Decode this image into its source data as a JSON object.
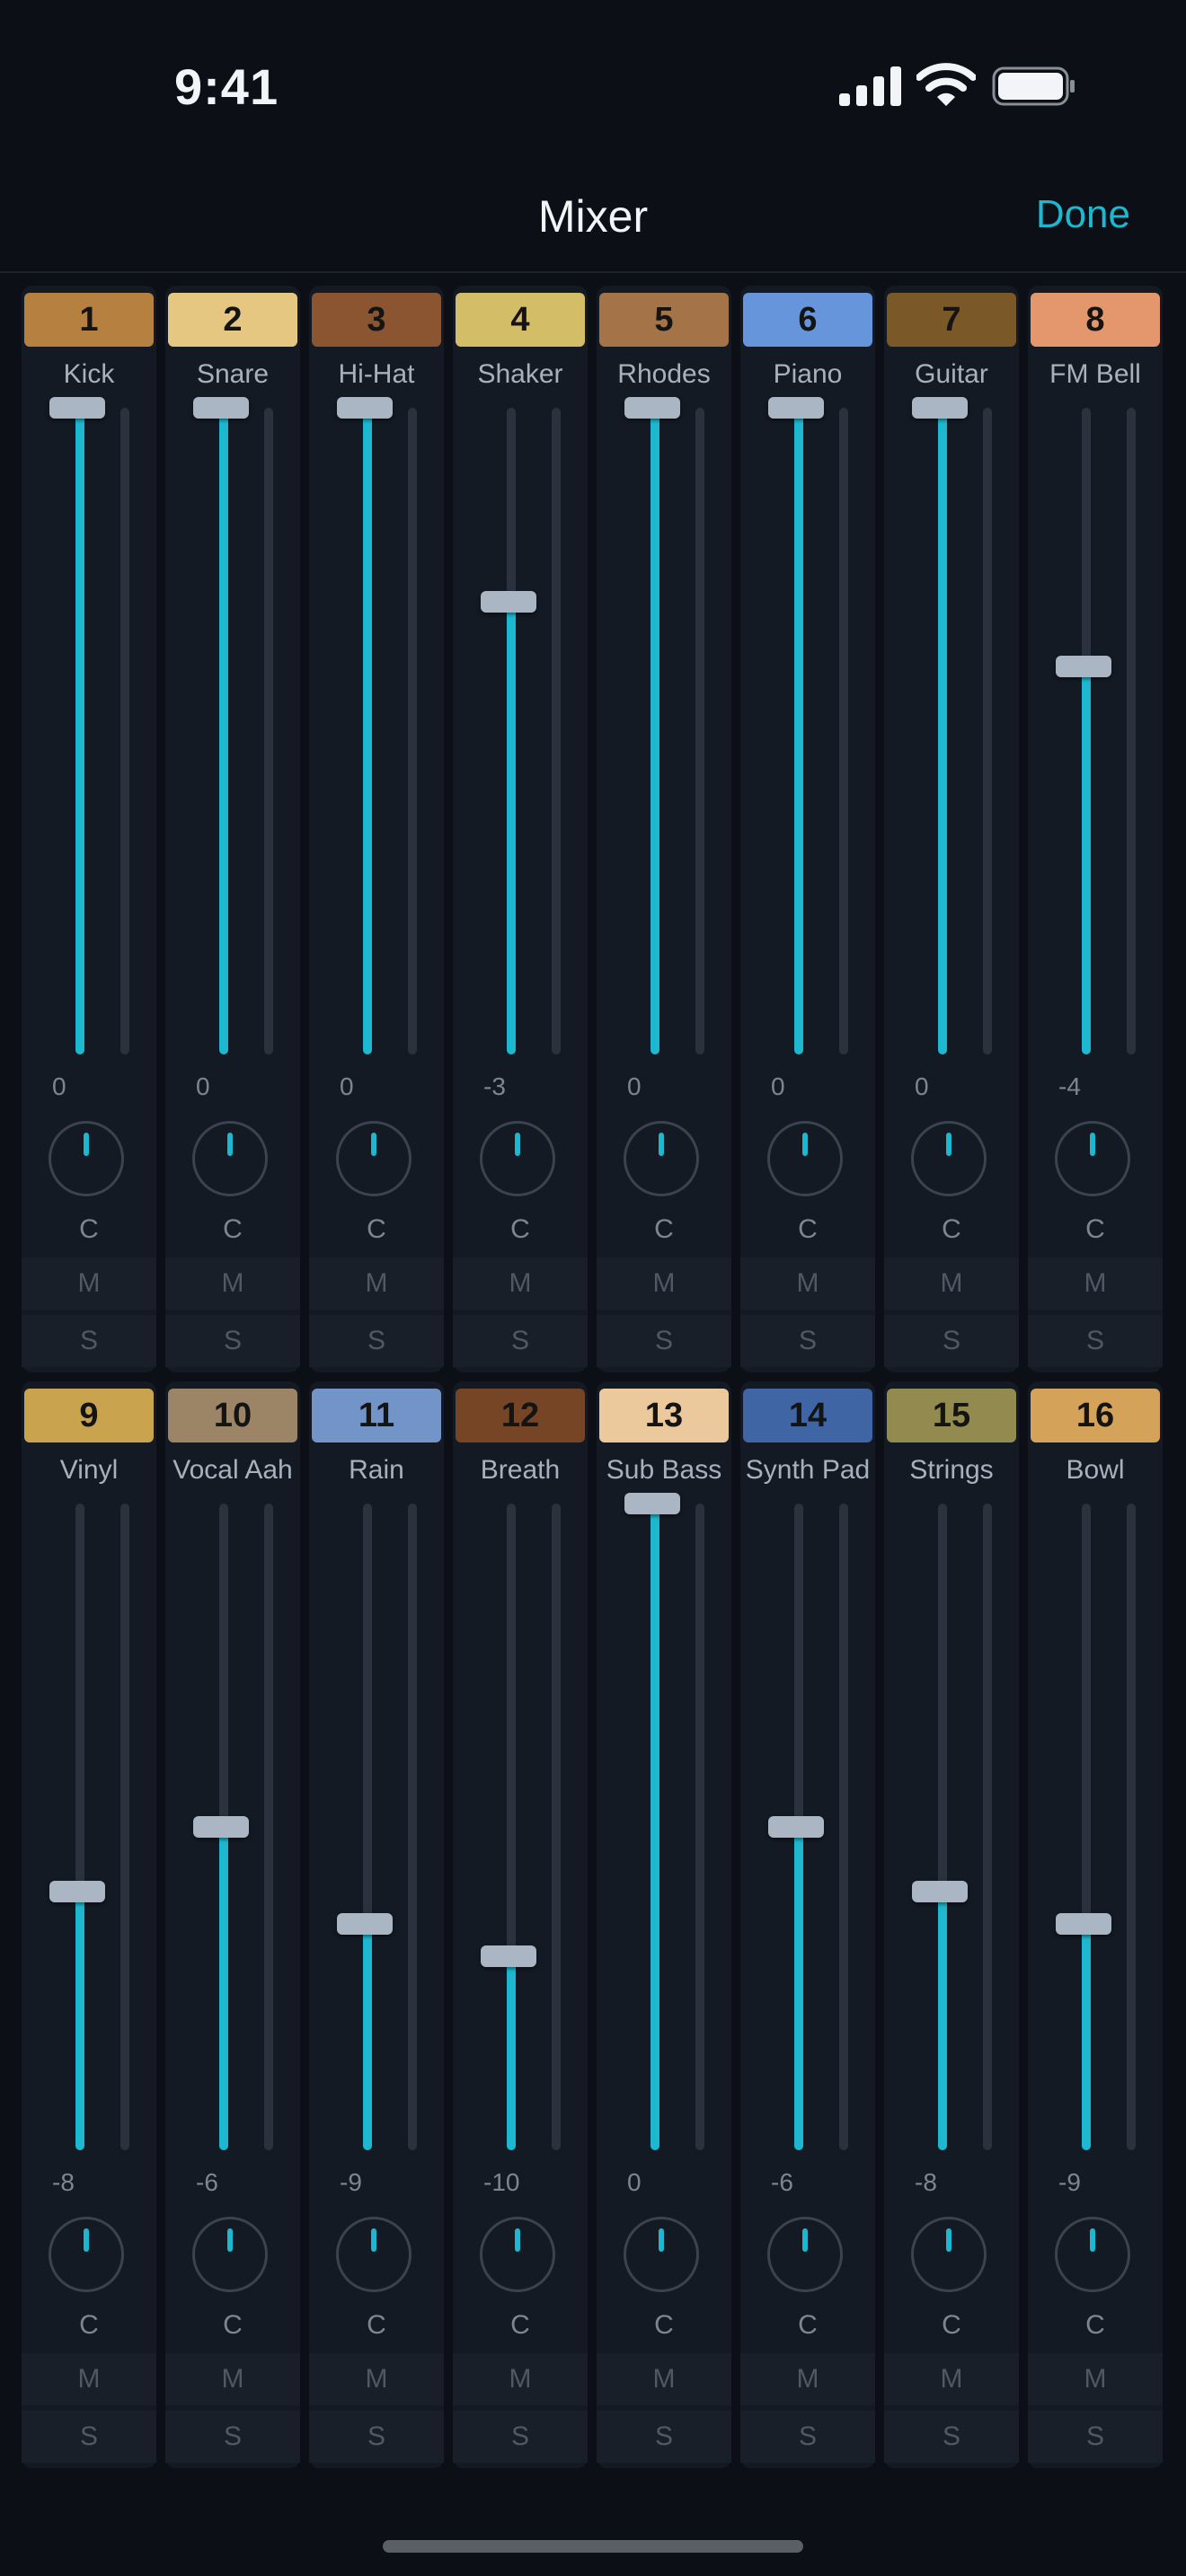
{
  "status_bar": {
    "time": "9:41"
  },
  "nav": {
    "title": "Mixer",
    "done_label": "Done"
  },
  "colors": {
    "accent": "#1db8cf",
    "background": "#0c1016",
    "strip": "#141a23"
  },
  "icons": [
    "signal-icon",
    "wifi-icon",
    "battery-icon"
  ],
  "channels": [
    {
      "number": "1",
      "name": "Kick",
      "color": "#b58040",
      "gain": "0",
      "level": 1.0,
      "pan": "C",
      "mute": "M",
      "solo": "S"
    },
    {
      "number": "2",
      "name": "Snare",
      "color": "#e6c781",
      "gain": "0",
      "level": 1.0,
      "pan": "C",
      "mute": "M",
      "solo": "S"
    },
    {
      "number": "3",
      "name": "Hi-Hat",
      "color": "#8a5530",
      "gain": "0",
      "level": 1.0,
      "pan": "C",
      "mute": "M",
      "solo": "S"
    },
    {
      "number": "4",
      "name": "Shaker",
      "color": "#d4bd67",
      "gain": "-3",
      "level": 0.7,
      "pan": "C",
      "mute": "M",
      "solo": "S"
    },
    {
      "number": "5",
      "name": "Rhodes",
      "color": "#a47348",
      "gain": "0",
      "level": 1.0,
      "pan": "C",
      "mute": "M",
      "solo": "S"
    },
    {
      "number": "6",
      "name": "Piano",
      "color": "#6695db",
      "gain": "0",
      "level": 1.0,
      "pan": "C",
      "mute": "M",
      "solo": "S"
    },
    {
      "number": "7",
      "name": "Guitar",
      "color": "#7a5828",
      "gain": "0",
      "level": 1.0,
      "pan": "C",
      "mute": "M",
      "solo": "S"
    },
    {
      "number": "8",
      "name": "FM Bell",
      "color": "#e4976d",
      "gain": "-4",
      "level": 0.6,
      "pan": "C",
      "mute": "M",
      "solo": "S"
    },
    {
      "number": "9",
      "name": "Vinyl",
      "color": "#c9a34e",
      "gain": "-8",
      "level": 0.4,
      "pan": "C",
      "mute": "M",
      "solo": "S"
    },
    {
      "number": "10",
      "name": "Vocal Aah",
      "color": "#9c8466",
      "gain": "-6",
      "level": 0.5,
      "pan": "C",
      "mute": "M",
      "solo": "S"
    },
    {
      "number": "11",
      "name": "Rain",
      "color": "#7394c8",
      "gain": "-9",
      "level": 0.35,
      "pan": "C",
      "mute": "M",
      "solo": "S"
    },
    {
      "number": "12",
      "name": "Breath",
      "color": "#764526",
      "gain": "-10",
      "level": 0.3,
      "pan": "C",
      "mute": "M",
      "solo": "S"
    },
    {
      "number": "13",
      "name": "Sub Bass",
      "color": "#ecc99c",
      "gain": "0",
      "level": 1.0,
      "pan": "C",
      "mute": "M",
      "solo": "S"
    },
    {
      "number": "14",
      "name": "Synth Pad",
      "color": "#3f65a4",
      "gain": "-6",
      "level": 0.5,
      "pan": "C",
      "mute": "M",
      "solo": "S"
    },
    {
      "number": "15",
      "name": "Strings",
      "color": "#928a4e",
      "gain": "-8",
      "level": 0.4,
      "pan": "C",
      "mute": "M",
      "solo": "S"
    },
    {
      "number": "16",
      "name": "Bowl",
      "color": "#d4a259",
      "gain": "-9",
      "level": 0.35,
      "pan": "C",
      "mute": "M",
      "solo": "S"
    }
  ]
}
